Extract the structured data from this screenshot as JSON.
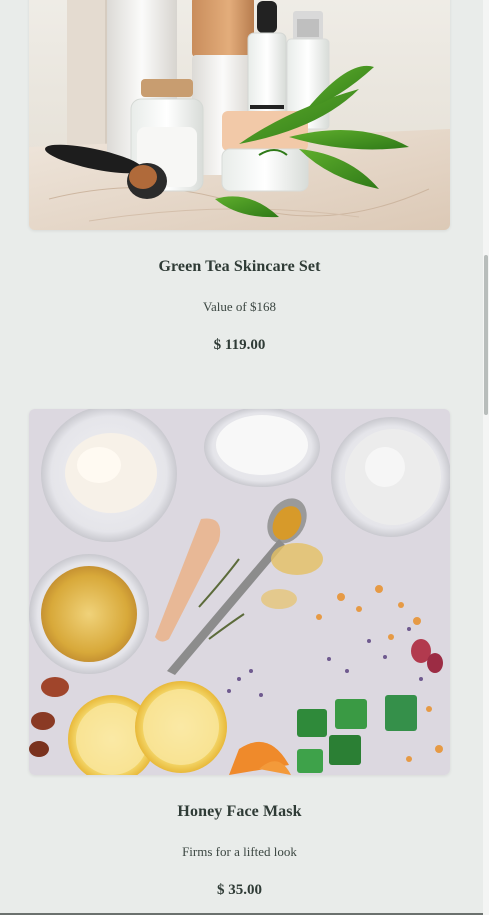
{
  "products": [
    {
      "title": "Green Tea Skincare Set",
      "subtitle": "Value of $168",
      "price": "$ 119.00",
      "image": "skincare-set-bottles-and-jars"
    },
    {
      "title": "Honey Face Mask",
      "subtitle": "Firms for a lifted look",
      "price": "$ 35.00",
      "image": "face-mask-ingredients-flatlay"
    }
  ]
}
